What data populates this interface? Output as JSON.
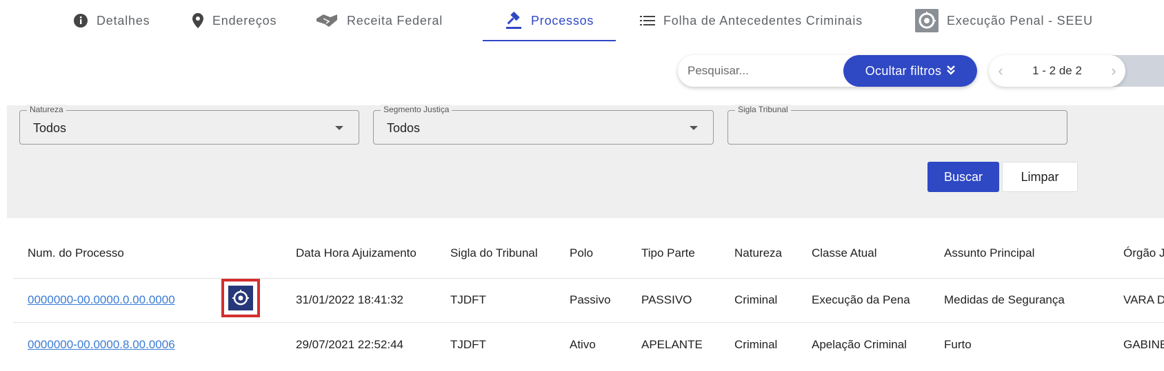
{
  "tabs": [
    {
      "label": "Detalhes",
      "icon": "info-icon"
    },
    {
      "label": "Endereços",
      "icon": "location-pin-icon"
    },
    {
      "label": "Receita Federal",
      "icon": "handshake-icon"
    },
    {
      "label": "Processos",
      "icon": "gavel-icon",
      "active": true
    },
    {
      "label": "Folha de Antecedentes Criminais",
      "icon": "list-icon"
    },
    {
      "label": "Execução Penal - SEEU",
      "icon": "seeu-icon"
    }
  ],
  "toolbar": {
    "search_placeholder": "Pesquisar...",
    "filter_button": "Ocultar filtros",
    "pager_text": "1 - 2 de 2"
  },
  "filters": {
    "natureza": {
      "label": "Natureza",
      "value": "Todos"
    },
    "segmento": {
      "label": "Segmento Justiça",
      "value": "Todos"
    },
    "sigla": {
      "label": "Sigla Tribunal",
      "value": ""
    },
    "buscar": "Buscar",
    "limpar": "Limpar"
  },
  "table": {
    "headers": [
      "Num. do Processo",
      "Data Hora Ajuizamento",
      "Sigla do Tribunal",
      "Polo",
      "Tipo Parte",
      "Natureza",
      "Classe Atual",
      "Assunto Principal",
      "Órgão Jul"
    ],
    "rows": [
      {
        "numero": "0000000-00.0000.0.00.0000",
        "data": "31/01/2022 18:41:32",
        "sigla": "TJDFT",
        "polo": "Passivo",
        "tipo": "PASSIVO",
        "natureza": "Criminal",
        "classe": "Execução da Pena",
        "assunto": "Medidas de Segurança",
        "orgao": "VARA DE"
      },
      {
        "numero": "0000000-00.0000.8.00.0006",
        "data": "29/07/2021 22:52:44",
        "sigla": "TJDFT",
        "polo": "Ativo",
        "tipo": "APELANTE",
        "natureza": "Criminal",
        "classe": "Apelação Criminal",
        "assunto": "Furto",
        "orgao": "GABINET"
      }
    ]
  },
  "colors": {
    "accent": "#2f48c4",
    "link": "#3a7bd5",
    "highlight": "#d32f2f",
    "seeu_badge": "#26387a"
  }
}
